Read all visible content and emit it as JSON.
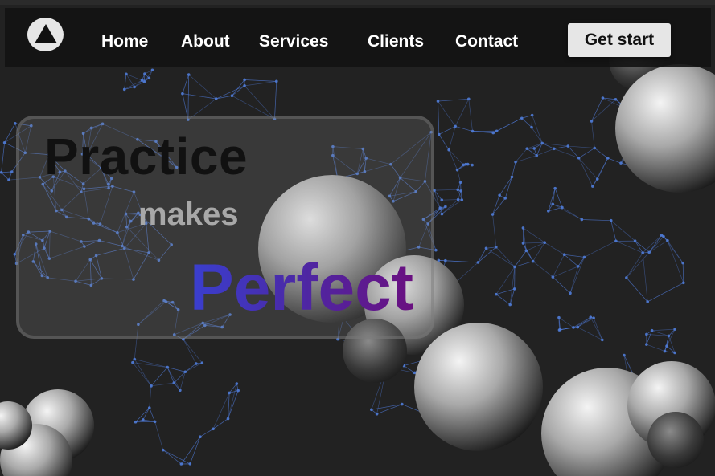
{
  "nav": {
    "logo_icon": "triangle-logo-icon",
    "links": [
      "Home",
      "About",
      "Services",
      "Clients",
      "Contact"
    ],
    "cta_label": "Get start"
  },
  "hero": {
    "line1": "Practice",
    "line2": "makes",
    "line3": "Perfect"
  },
  "colors": {
    "background": "#222222",
    "navbar": "#141414",
    "network": "#4f7bd6",
    "perfect_gradient": [
      "#3a3fcf",
      "#6a1080"
    ]
  }
}
